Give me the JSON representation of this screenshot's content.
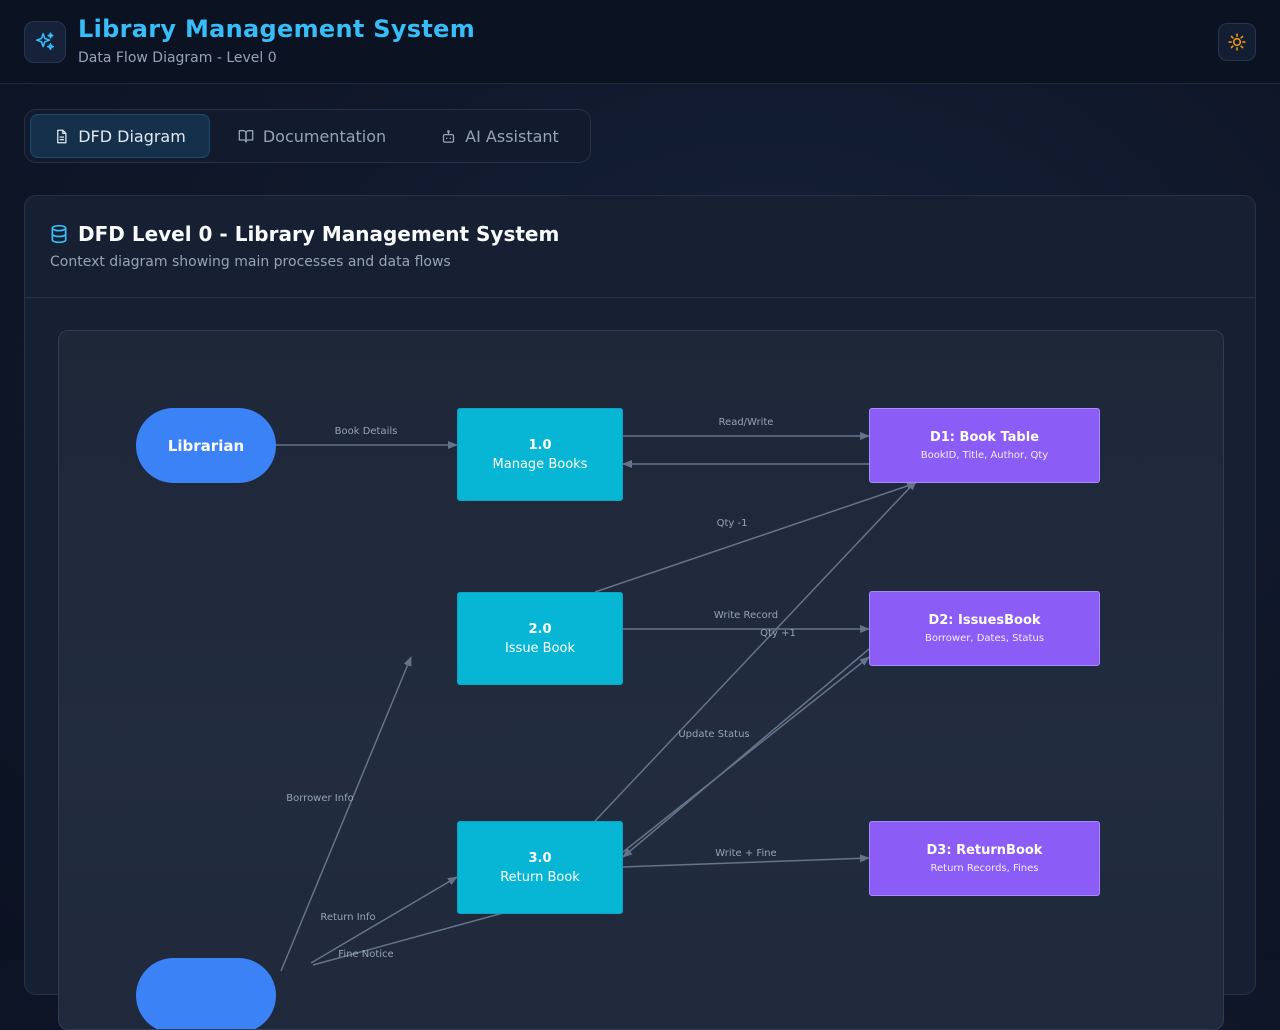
{
  "header": {
    "title": "Library Management System",
    "subtitle": "Data Flow Diagram - Level 0",
    "logo_icon": "sparkles-icon",
    "theme_icon": "sun-icon",
    "accent": "#38bdf8"
  },
  "tabs": [
    {
      "label": "DFD Diagram",
      "icon": "document-icon",
      "active": true
    },
    {
      "label": "Documentation",
      "icon": "book-icon",
      "active": false
    },
    {
      "label": "AI Assistant",
      "icon": "bot-icon",
      "active": false
    }
  ],
  "card": {
    "title": "DFD Level 0 - Library Management System",
    "description": "Context diagram showing main processes and data flows",
    "icon": "database-icon"
  },
  "diagram": {
    "entities": [
      {
        "label": "Librarian",
        "color": "#3b82f6"
      }
    ],
    "processes": [
      {
        "id": "1.0",
        "name": "Manage Books",
        "color": "#06b6d4"
      },
      {
        "id": "2.0",
        "name": "Issue Book",
        "color": "#06b6d4"
      },
      {
        "id": "3.0",
        "name": "Return Book",
        "color": "#06b6d4"
      }
    ],
    "stores": [
      {
        "name": "D1: Book Table",
        "fields": "BookID, Title, Author, Qty",
        "color": "#8b5cf6"
      },
      {
        "name": "D2: IssuesBook",
        "fields": "Borrower, Dates, Status",
        "color": "#8b5cf6"
      },
      {
        "name": "D3: ReturnBook",
        "fields": "Return Records, Fines",
        "color": "#8b5cf6"
      }
    ],
    "flows": [
      {
        "label": "Book Details"
      },
      {
        "label": "Read/Write"
      },
      {
        "label": "Qty -1"
      },
      {
        "label": "Write Record"
      },
      {
        "label": "Qty +1"
      },
      {
        "label": "Update Status"
      },
      {
        "label": "Borrower Info"
      },
      {
        "label": "Write + Fine"
      },
      {
        "label": "Return Info"
      },
      {
        "label": "Fine Notice"
      }
    ]
  }
}
